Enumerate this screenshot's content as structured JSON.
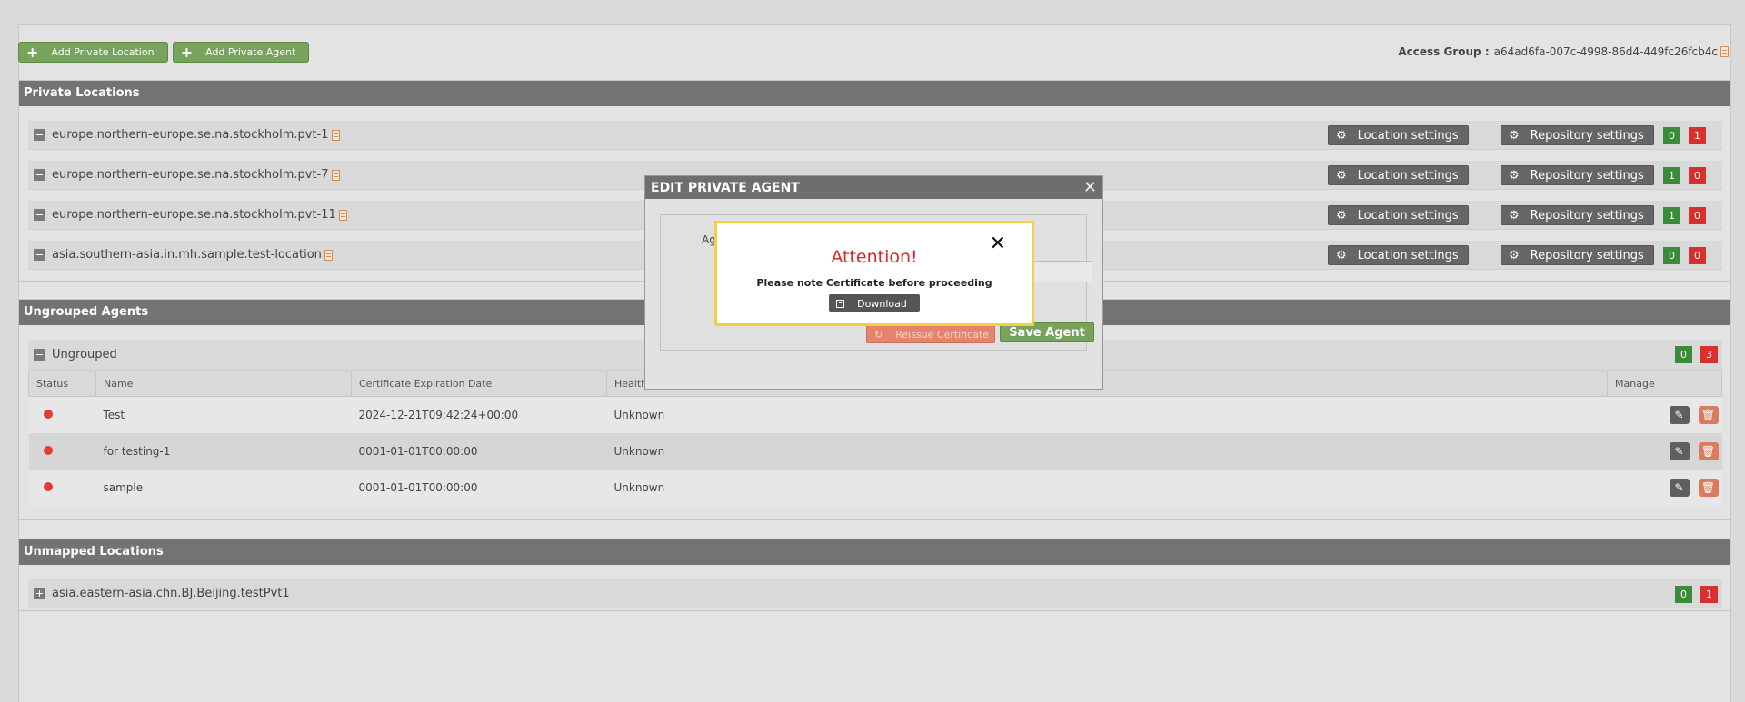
{
  "toolbar": {
    "add_location_label": "Add Private Location",
    "add_agent_label": "Add Private Agent",
    "access_group_label": "Access Group :",
    "access_group_value": "a64ad6fa-007c-4998-86d4-449fc26fcb4c"
  },
  "private_locations": {
    "title": "Private Locations",
    "location_settings_label": "Location settings",
    "repository_settings_label": "Repository settings",
    "rows": [
      {
        "name": "europe.northern-europe.se.na.stockholm.pvt-1",
        "green": "0",
        "red": "1"
      },
      {
        "name": "europe.northern-europe.se.na.stockholm.pvt-7",
        "green": "1",
        "red": "0"
      },
      {
        "name": "europe.northern-europe.se.na.stockholm.pvt-11",
        "green": "1",
        "red": "0"
      },
      {
        "name": "asia.southern-asia.in.mh.sample.test-location",
        "green": "0",
        "red": "0"
      }
    ]
  },
  "ungrouped_agents": {
    "title": "Ungrouped Agents",
    "group_name": "Ungrouped",
    "green": "0",
    "red": "3",
    "columns": [
      "Status",
      "Name",
      "Certificate Expiration Date",
      "Health",
      "Manage"
    ],
    "rows": [
      {
        "name": "Test",
        "expiration": "2024-12-21T09:42:24+00:00",
        "health": "Unknown"
      },
      {
        "name": "for testing-1",
        "expiration": "0001-01-01T00:00:00",
        "health": "Unknown"
      },
      {
        "name": "sample",
        "expiration": "0001-01-01T00:00:00",
        "health": "Unknown"
      }
    ]
  },
  "unmapped_locations": {
    "title": "Unmapped Locations",
    "rows": [
      {
        "name": "asia.eastern-asia.chn.BJ.Beijing.testPvt1",
        "green": "0",
        "red": "1"
      }
    ]
  },
  "edit_modal": {
    "title": "EDIT PRIVATE AGENT",
    "partial_label": "Ag",
    "reissue_label": "Reissue Certificate",
    "save_label": "Save Agent"
  },
  "alert": {
    "title": "Attention!",
    "message": "Please note Certificate before proceeding",
    "download_label": "Download"
  },
  "colors": {
    "green_button": "#78a35c",
    "header_gray": "#737373",
    "count_green": "#3a8b3a",
    "count_red": "#d9302f",
    "alert_border": "#f4d03f",
    "alert_title": "#e02424"
  },
  "icons": [
    "plus-icon",
    "clipboard-icon",
    "gear-icon",
    "collapse-icon",
    "expand-icon",
    "edit-icon",
    "trash-icon",
    "close-icon",
    "floppy-icon",
    "refresh-icon",
    "status-dot"
  ]
}
